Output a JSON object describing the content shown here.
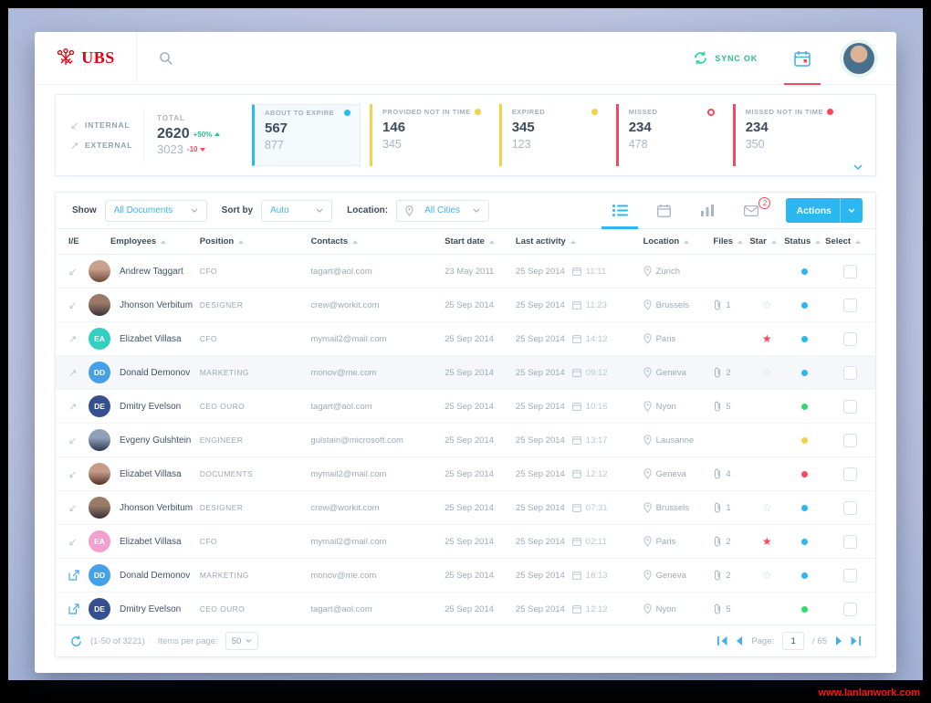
{
  "watermark": "www.lanlanwork.com",
  "header": {
    "logo_text": "UBS",
    "sync_label": "SYNC OK"
  },
  "stats": {
    "internal_label": "INTERNAL",
    "external_label": "EXTERNAL",
    "total": {
      "label": "TOTAL",
      "internal_value": "2620",
      "internal_change": "+50%",
      "external_value": "3023",
      "external_change": "-10"
    },
    "cards": [
      {
        "label": "ABOUT TO EXPIRE",
        "value1": "567",
        "value2": "877",
        "color": "#2bb7f0",
        "marker": "dot",
        "active": true
      },
      {
        "label": "PROVIDED NOT IN TIME",
        "value1": "146",
        "value2": "345",
        "color": "#f3d148",
        "marker": "dot",
        "active": false
      },
      {
        "label": "EXPIRED",
        "value1": "345",
        "value2": "123",
        "color": "#f3d148",
        "marker": "dot",
        "active": false
      },
      {
        "label": "MISSED",
        "value1": "234",
        "value2": "478",
        "color": "#f8485e",
        "marker": "ring",
        "active": false
      },
      {
        "label": "MISSED NOT IN TIME",
        "value1": "234",
        "value2": "350",
        "color": "#f8485e",
        "marker": "dot",
        "active": false
      }
    ]
  },
  "toolbar": {
    "show_label": "Show",
    "show_value": "All Documents",
    "sort_label": "Sort by",
    "sort_value": "Auto",
    "location_label": "Location:",
    "location_value": "All Cities",
    "mail_badge": "2",
    "actions_label": "Actions"
  },
  "table": {
    "columns": [
      "I/E",
      "Employees",
      "Position",
      "Contacts",
      "Start date",
      "Last activity",
      "Location",
      "Files",
      "Star",
      "Status",
      "Select"
    ],
    "status_colors": {
      "blue": "#2bb7f0",
      "green": "#2fd96e",
      "yellow": "#f3d148",
      "red": "#f8485e"
    },
    "rows": [
      {
        "ie": "in",
        "avatar": {
          "kind": "photo",
          "c1": "#caa08a",
          "c2": "#6b4a3c"
        },
        "name": "Andrew Taggart",
        "position": "CFO",
        "contact": "tagart@aol.com",
        "start_date": "23 May 2011",
        "activity_date": "25 Sep 2014",
        "activity_time": "11:11",
        "location": "Zurich",
        "files": "",
        "star": "",
        "status": "blue",
        "highlight": false
      },
      {
        "ie": "in",
        "avatar": {
          "kind": "photo",
          "c1": "#9a7b68",
          "c2": "#3c3038"
        },
        "name": "Jhonson Verbitum",
        "position": "DESIGNER",
        "contact": "crew@workit.com",
        "start_date": "25 Sep 2014",
        "activity_date": "25 Sep 2014",
        "activity_time": "11:23",
        "location": "Brussels",
        "files": "1",
        "star": "outline",
        "status": "blue",
        "highlight": false
      },
      {
        "ie": "out",
        "avatar": {
          "kind": "initials",
          "bg": "#33cfc0",
          "text": "EA"
        },
        "name": "Elizabet Villasa",
        "position": "CFO",
        "contact": "mymail2@mail.com",
        "start_date": "25 Sep 2014",
        "activity_date": "25 Sep 2014",
        "activity_time": "14:12",
        "location": "Paris",
        "files": "",
        "star": "filled",
        "status": "blue",
        "highlight": false
      },
      {
        "ie": "out",
        "avatar": {
          "kind": "initials",
          "bg": "#46a0e8",
          "text": "DD"
        },
        "name": "Donald Demonov",
        "position": "MARKETING",
        "contact": "monov@me.com",
        "start_date": "25 Sep 2014",
        "activity_date": "25 Sep 2014",
        "activity_time": "09:12",
        "location": "Geneva",
        "files": "2",
        "star": "outline",
        "status": "blue",
        "highlight": true
      },
      {
        "ie": "out",
        "avatar": {
          "kind": "initials",
          "bg": "#35508f",
          "text": "DE"
        },
        "name": "Dmitry Evelson",
        "position": "CEO OURO",
        "contact": "tagart@aol.com",
        "start_date": "25 Sep 2014",
        "activity_date": "25 Sep 2014",
        "activity_time": "10:16",
        "location": "Nyon",
        "files": "5",
        "star": "",
        "status": "green",
        "highlight": false
      },
      {
        "ie": "in",
        "avatar": {
          "kind": "photo",
          "c1": "#8fa0b8",
          "c2": "#2c3850"
        },
        "name": "Evgeny Gulshtein",
        "position": "ENGINEER",
        "contact": "gulstain@microsoft.com",
        "start_date": "25 Sep 2014",
        "activity_date": "25 Sep 2014",
        "activity_time": "13:17",
        "location": "Lausanne",
        "files": "",
        "star": "",
        "status": "yellow",
        "highlight": false
      },
      {
        "ie": "in",
        "avatar": {
          "kind": "photo",
          "c1": "#c89a88",
          "c2": "#503028"
        },
        "name": "Elizabet Villasa",
        "position": "DOCUMENTS",
        "contact": "mymail2@mail.com",
        "start_date": "25 Sep 2014",
        "activity_date": "25 Sep 2014",
        "activity_time": "12:12",
        "location": "Geneva",
        "files": "4",
        "star": "",
        "status": "red",
        "highlight": false
      },
      {
        "ie": "in",
        "avatar": {
          "kind": "photo",
          "c1": "#9a7b68",
          "c2": "#3c3038"
        },
        "name": "Jhonson Verbitum",
        "position": "DESIGNER",
        "contact": "crew@workit.com",
        "start_date": "25 Sep 2014",
        "activity_date": "25 Sep 2014",
        "activity_time": "07:31",
        "location": "Brussels",
        "files": "1",
        "star": "outline",
        "status": "blue",
        "highlight": false
      },
      {
        "ie": "in",
        "avatar": {
          "kind": "initials",
          "bg": "#f2a0cf",
          "text": "EA"
        },
        "name": "Elizabet Villasa",
        "position": "CFO",
        "contact": "mymail2@mail.com",
        "start_date": "25 Sep 2014",
        "activity_date": "25 Sep 2014",
        "activity_time": "02:11",
        "location": "Paris",
        "files": "2",
        "star": "filled",
        "status": "blue",
        "highlight": false
      },
      {
        "ie": "link",
        "avatar": {
          "kind": "initials",
          "bg": "#46a0e8",
          "text": "DD"
        },
        "name": "Donald Demonov",
        "position": "MARKETING",
        "contact": "monov@me.com",
        "start_date": "25 Sep 2014",
        "activity_date": "25 Sep 2014",
        "activity_time": "16:13",
        "location": "Geneva",
        "files": "2",
        "star": "outline",
        "status": "blue",
        "highlight": false
      },
      {
        "ie": "link",
        "avatar": {
          "kind": "initials",
          "bg": "#35508f",
          "text": "DE"
        },
        "name": "Dmitry Evelson",
        "position": "CEO OURO",
        "contact": "tagart@aol.com",
        "start_date": "25 Sep 2014",
        "activity_date": "25 Sep 2014",
        "activity_time": "12:12",
        "location": "Nyon",
        "files": "5",
        "star": "",
        "status": "green",
        "highlight": false
      }
    ]
  },
  "footer": {
    "range": "(1-50 of 3221)",
    "per_page_label": "Items per page:",
    "per_page_value": "50",
    "page_label": "Page:",
    "page_value": "1",
    "page_total": "/ 65"
  }
}
